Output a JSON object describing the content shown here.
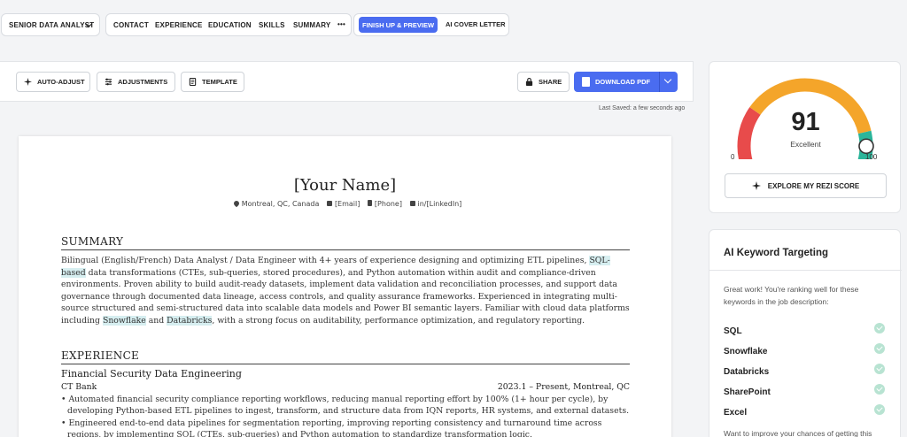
{
  "nav": {
    "role": "SENIOR DATA ANALYST",
    "sections": [
      "CONTACT",
      "EXPERIENCE",
      "EDUCATION",
      "SKILLS",
      "SUMMARY"
    ],
    "more": "•••",
    "finish": "FINISH UP & PREVIEW",
    "ai_cover": "AI COVER LETTER"
  },
  "toolbar": {
    "auto_adjust": "AUTO-ADJUST",
    "adjustments": "ADJUSTMENTS",
    "template": "TEMPLATE",
    "share": "SHARE",
    "download": "DOWNLOAD PDF",
    "last_saved": "Last Saved: a few seconds ago"
  },
  "resume": {
    "name": "[Your Name]",
    "location": "Montreal, QC, Canada",
    "email": "[Email]",
    "phone": "[Phone]",
    "linkedin": "in/[LinkedIn]",
    "summary_heading": "SUMMARY",
    "summary": {
      "p1": "Bilingual (English/French) Data Analyst / Data Engineer with 4+ years of experience designing and optimizing ETL pipelines, ",
      "k1": "SQL-based",
      "p2": " data transformations (CTEs, sub-queries, stored procedures), and Python automation within audit and compliance-driven environments. Proven ability to build audit-ready datasets, implement data validation and reconciliation processes, and support data governance through documented data lineage, access controls, and quality assurance frameworks. Experienced in integrating multi-source structured and semi-structured data into scalable data models and Power BI semantic layers. Familiar with cloud data platforms including ",
      "k2": "Snowflake",
      "p3": " and ",
      "k3": "Databricks",
      "p4": ", with a strong focus on auditability, performance optimization, and regulatory reporting."
    },
    "experience_heading": "EXPERIENCE",
    "job": {
      "title": "Financial Security Data Engineering",
      "company": "CT Bank",
      "dates": "2023.1 – Present,  Montreal, QC",
      "bullets": [
        "• Automated financial security compliance reporting workflows, reducing manual reporting effort by 100% (1+ hour per cycle), by developing Python-based ETL pipelines to ingest, transform, and structure data from IQN reports, HR systems, and external datasets.",
        "• Engineered end-to-end data pipelines for segmentation reporting, improving reporting consistency and turnaround time across regions, by implementing SQL (CTEs, sub-queries) and Python automation to standardize transformation logic."
      ]
    }
  },
  "score": {
    "value": "91",
    "label": "Excellent",
    "min": "0",
    "max": "100",
    "fraction": 0.91,
    "explore": "EXPLORE MY REZI SCORE",
    "colors": {
      "red": "#e84b4b",
      "orange": "#f4a52a",
      "teal": "#2bb59a"
    }
  },
  "keywords": {
    "title": "AI Keyword Targeting",
    "desc": "Great work! You're ranking well for these keywords in the job description:",
    "items": [
      "SQL",
      "Snowflake",
      "Databricks",
      "SharePoint",
      "Excel"
    ],
    "more": "Want to improve your chances of getting this"
  }
}
